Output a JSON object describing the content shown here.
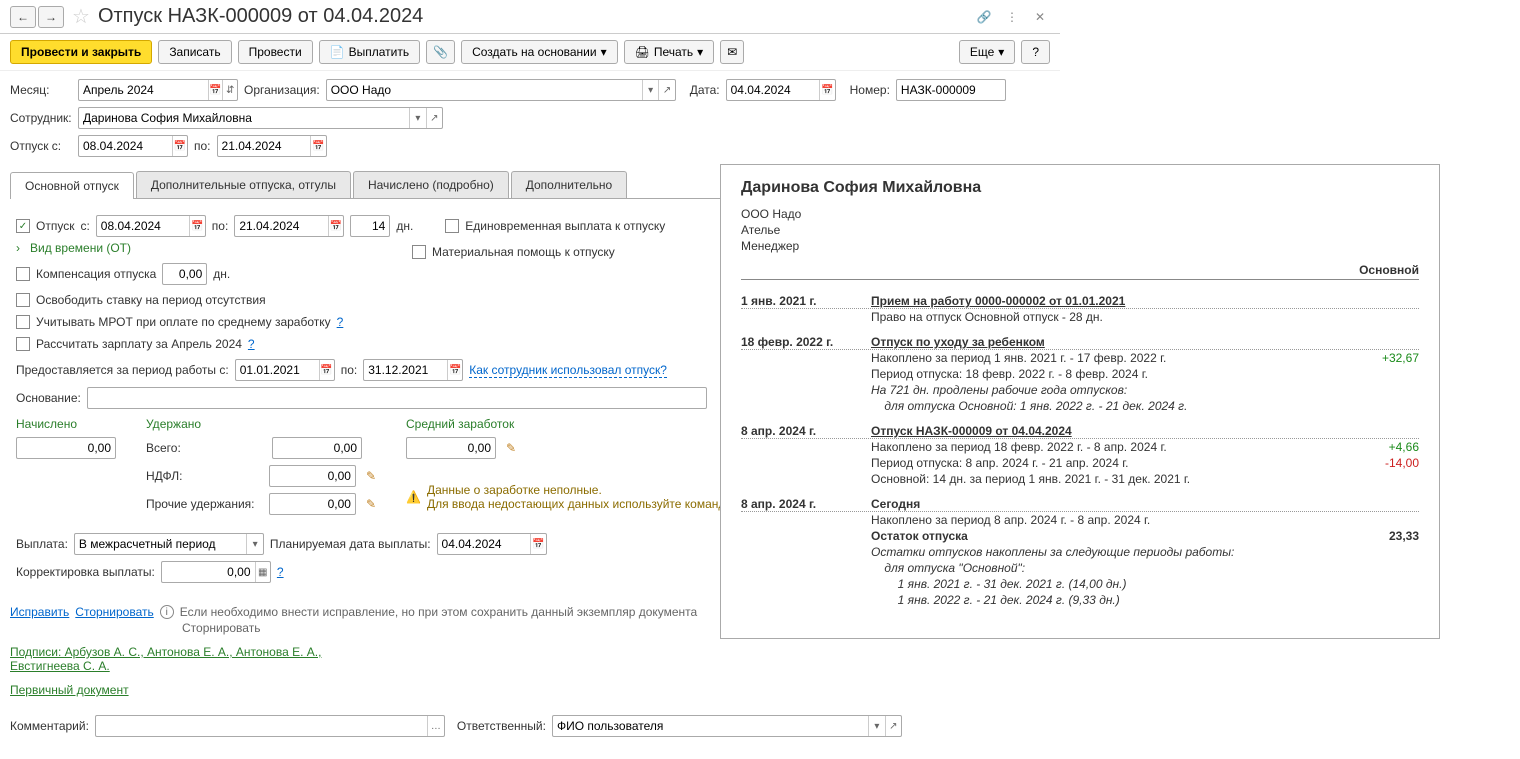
{
  "header": {
    "title": "Отпуск НАЗК-000009 от 04.04.2024"
  },
  "toolbar": {
    "provesti_zakryt": "Провести и закрыть",
    "zapisat": "Записать",
    "provesti": "Провести",
    "vyplatit": "Выплатить",
    "sozdat_na_osnovanii": "Создать на основании",
    "pechat": "Печать",
    "esche": "Еще",
    "help": "?"
  },
  "fields": {
    "mesyac_label": "Месяц:",
    "mesyac_value": "Апрель 2024",
    "org_label": "Организация:",
    "org_value": "ООО Надо",
    "data_label": "Дата:",
    "data_value": "04.04.2024",
    "nomer_label": "Номер:",
    "nomer_value": "НАЗК-000009",
    "sotrudnik_label": "Сотрудник:",
    "sotrudnik_value": "Даринова София Михайловна",
    "otpusk_s_label": "Отпуск с:",
    "otpusk_s_value": "08.04.2024",
    "po_label": "по:",
    "otpusk_po_value": "21.04.2024"
  },
  "tabs": {
    "t1": "Основной отпуск",
    "t2": "Дополнительные отпуска, отгулы",
    "t3": "Начислено (подробно)",
    "t4": "Дополнительно"
  },
  "main_tab": {
    "otpusk_check": "Отпуск",
    "s_label": "с:",
    "s_value": "08.04.2024",
    "po_label": "по:",
    "po_value": "21.04.2024",
    "days_value": "14",
    "days_suffix": "дн.",
    "lump_sum": "Единовременная выплата к отпуску",
    "mat_help": "Материальная помощь к отпуску",
    "vid_vremeni": "Вид времени (ОТ)",
    "komp_label": "Компенсация отпуска",
    "komp_value": "0,00",
    "komp_suffix": "дн.",
    "osvobodit": "Освободить ставку на период отсутствия",
    "mrot": "Учитывать МРОТ при оплате по среднему заработку",
    "rasschitat": "Рассчитать зарплату за Апрель 2024",
    "period_label": "Предоставляется за период работы с:",
    "period_from": "01.01.2021",
    "period_to_label": "по:",
    "period_to": "31.12.2021",
    "kak_ispol": "Как сотрудник использовал отпуск?",
    "osnovanie_label": "Основание:"
  },
  "calc": {
    "nachisleno_head": "Начислено",
    "uderzhano_head": "Удержано",
    "sredniy_head": "Средний заработок",
    "nachisleno_val": "0,00",
    "vsego_label": "Всего:",
    "vsego_val": "0,00",
    "ndfl_label": "НДФЛ:",
    "ndfl_val": "0,00",
    "prochie_label": "Прочие удержания:",
    "prochie_val": "0,00",
    "sredniy_val": "0,00",
    "warn1": "Данные о заработке неполные.",
    "warn2": "Для ввода недостающих данных используйте команду"
  },
  "payout": {
    "vyplata_label": "Выплата:",
    "vyplata_value": "В межрасчетный период",
    "plan_label": "Планируемая дата выплаты:",
    "plan_value": "04.04.2024",
    "korr_label": "Корректировка выплаты:",
    "korr_value": "0,00"
  },
  "footer": {
    "ispravit": "Исправить",
    "storn": "Сторнировать",
    "note": "Если необходимо внести исправление, но при этом сохранить данный экземпляр документа",
    "storn_line": "Сторнировать",
    "podpisi": "Подписи: Арбузов А. С., Антонова Е. А., Антонова Е. А.,",
    "evst": "Евстигнеева С. А.",
    "pervichniy": "Первичный документ",
    "komment_label": "Комментарий:",
    "otvet_label": "Ответственный:",
    "otvet_value": "ФИО пользователя"
  },
  "panel": {
    "name": "Даринова София Михайловна",
    "org": "ООО Надо",
    "dept": "Ателье",
    "pos": "Менеджер",
    "section": "Основной",
    "events": [
      {
        "date": "1 янв. 2021 г.",
        "title": "Прием на работу 0000-000002 от 01.01.2021",
        "lines": [
          {
            "text": "Право на отпуск Основной отпуск - 28 дн."
          }
        ]
      },
      {
        "date": "18 февр. 2022 г.",
        "title": "Отпуск по уходу за ребенком",
        "lines": [
          {
            "text": "Накоплено за период 1 янв. 2021 г. - 17 февр. 2022 г.",
            "amount": "+32,67",
            "pos": true
          },
          {
            "text": "Период отпуска: 18 февр. 2022 г. - 8 февр. 2024 г."
          },
          {
            "text": "На 721 дн. продлены рабочие года отпусков:",
            "italic": true
          },
          {
            "text": "    для отпуска Основной: 1 янв. 2022 г. - 21 дек. 2024 г.",
            "italic": true
          }
        ]
      },
      {
        "date": "8 апр. 2024 г.",
        "title": "Отпуск НАЗК-000009 от 04.04.2024",
        "lines": [
          {
            "text": "Накоплено за период 18 февр. 2022 г. - 8 апр. 2024 г.",
            "amount": "+4,66",
            "pos": true
          },
          {
            "text": "Период отпуска: 8 апр. 2024 г. - 21 апр. 2024 г.",
            "amount": "-14,00",
            "neg": true
          },
          {
            "text": "Основной: 14 дн. за период 1 янв. 2021 г. - 31 дек. 2021 г."
          }
        ]
      },
      {
        "date": "8 апр. 2024 г.",
        "title": "Сегодня",
        "plain_title": true,
        "lines": [
          {
            "text": "Накоплено за период 8 апр. 2024 г. - 8 апр. 2024 г."
          },
          {
            "text": "Остаток отпуска",
            "bold": true,
            "amount": "23,33",
            "amount_bold": true
          },
          {
            "text": "Остатки отпусков накоплены за следующие периоды работы:",
            "italic": true
          },
          {
            "text": "    для отпуска \"Основной\":",
            "italic": true
          },
          {
            "text": "        1 янв. 2021 г. - 31 дек. 2021 г. (14,00 дн.)",
            "italic": true
          },
          {
            "text": "        1 янв. 2022 г. - 21 дек. 2024 г. (9,33 дн.)",
            "italic": true
          }
        ]
      }
    ]
  }
}
